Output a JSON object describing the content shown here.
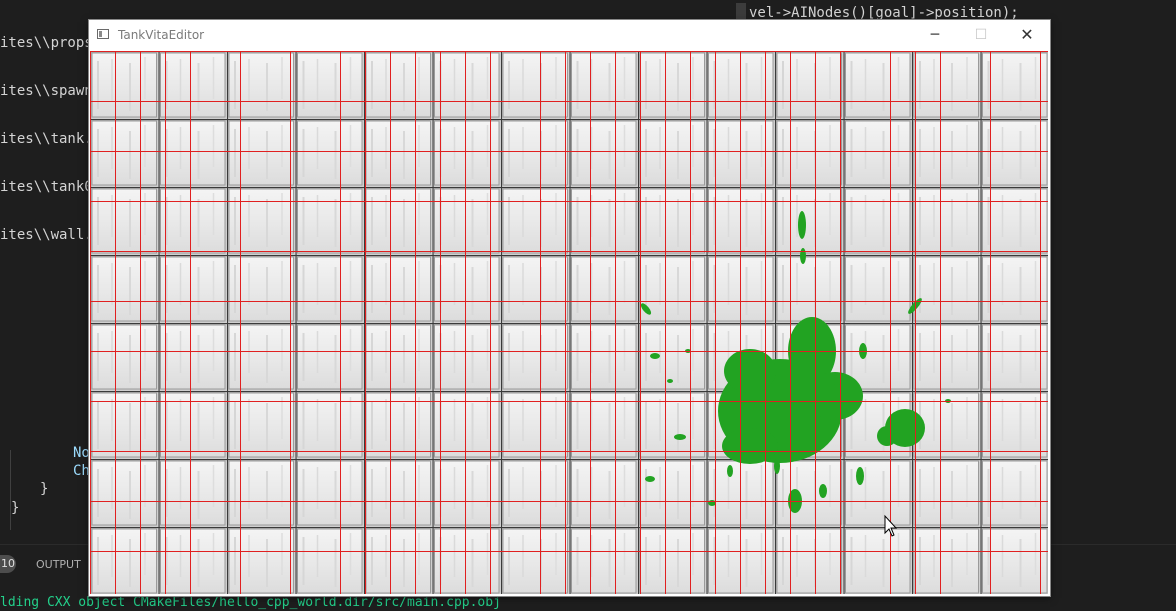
{
  "background_editor": {
    "code_left_lines": [
      "ites\\\\props\\\\barrel.png\"",
      "ites\\\\spawn",
      "ites\\\\tank.",
      "ites\\\\tank0.",
      "ites\\\\wall."
    ],
    "code_right_line": "vel->AINodes()[goal]->position);",
    "code_lower": {
      "line1": "No",
      "line2": "Ch",
      "brace_inner": "}",
      "brace_outer": "}"
    },
    "panel": {
      "badge": "10",
      "output_tab": "OUTPUT"
    },
    "build_output": "lding CXX object CMakeFiles/hello_cpp_world.dir/src/main.cpp.obj"
  },
  "window": {
    "title": "TankVitaEditor",
    "buttons": {
      "minimize": "─",
      "maximize": "☐",
      "close": "✕"
    },
    "icon": "app-window-icon"
  },
  "canvas": {
    "tile_floor": "metal-plate-tiles",
    "grid_color": "#e02020",
    "splat_color": "#22a322",
    "cursor": "mouse-pointer-icon"
  }
}
